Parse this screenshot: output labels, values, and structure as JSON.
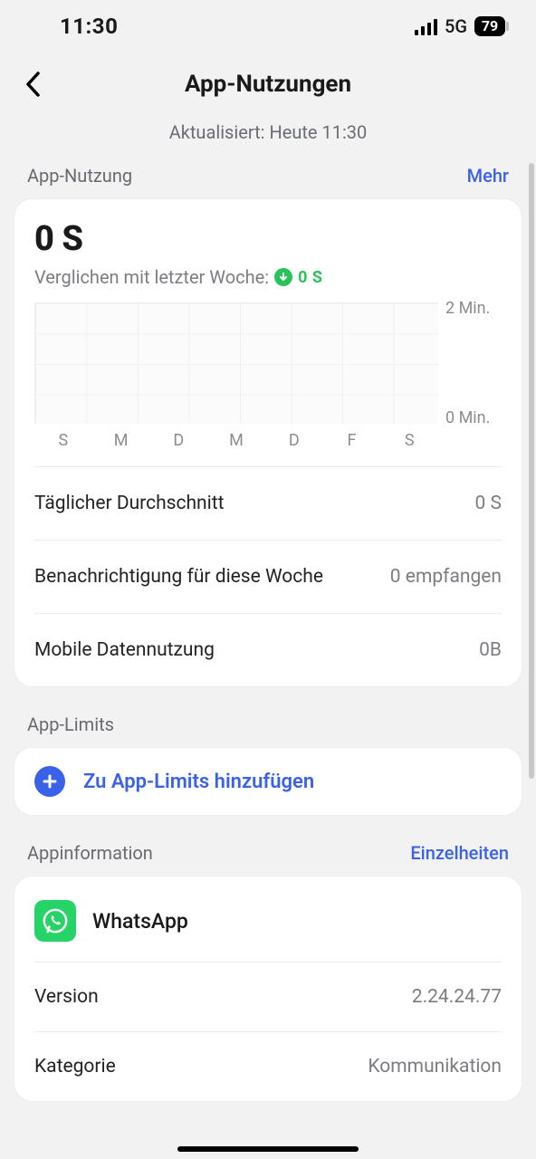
{
  "status": {
    "time": "11:30",
    "network": "5G",
    "battery": "79"
  },
  "header": {
    "title": "App-Nutzungen",
    "updated": "Aktualisiert: Heute 11:30"
  },
  "usage_section": {
    "label": "App-Nutzung",
    "more": "Mehr",
    "total_time": "0 S",
    "compare_prefix": "Verglichen mit letzter Woche:",
    "delta": "0 S",
    "stats": {
      "daily_avg_label": "Täglicher Durchschnitt",
      "daily_avg_value": "0 S",
      "notifications_label": "Benachrichtigung für diese Woche",
      "notifications_value": "0 empfangen",
      "mobile_data_label": "Mobile Datennutzung",
      "mobile_data_value": "0B"
    }
  },
  "limits_section": {
    "label": "App-Limits",
    "add_label": "Zu App-Limits hinzufügen"
  },
  "appinfo_section": {
    "label": "Appinformation",
    "details": "Einzelheiten",
    "app_name": "WhatsApp",
    "version_label": "Version",
    "version_value": "2.24.24.77",
    "category_label": "Kategorie",
    "category_value": "Kommunikation"
  },
  "chart_data": {
    "type": "bar",
    "categories": [
      "S",
      "M",
      "D",
      "M",
      "D",
      "F",
      "S"
    ],
    "values": [
      0,
      0,
      0,
      0,
      0,
      0,
      0
    ],
    "ylabel_top": "2 Min.",
    "ylabel_bottom": "0 Min.",
    "ylim": [
      0,
      2
    ],
    "y_unit": "Min.",
    "title": "",
    "xlabel": "",
    "ylabel": ""
  }
}
